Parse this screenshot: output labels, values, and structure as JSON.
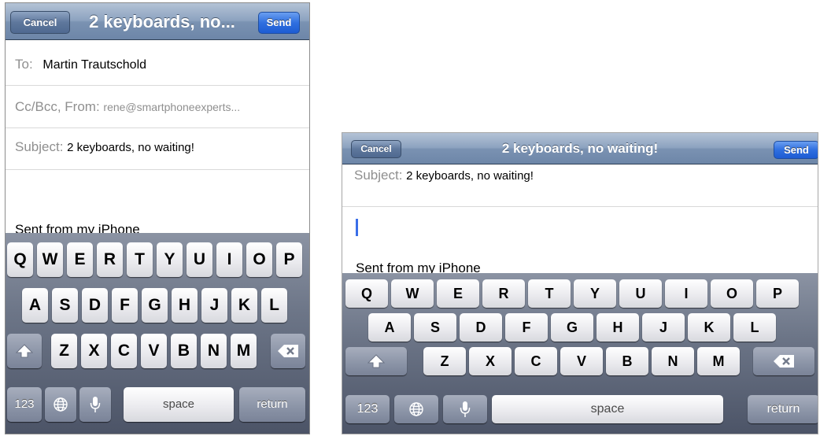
{
  "portrait": {
    "nav": {
      "cancel_label": "Cancel",
      "title": "2 keyboards, no...",
      "send_label": "Send"
    },
    "to": {
      "label": "To:",
      "value": "Martin Trautschold"
    },
    "ccbcc": {
      "label": "Cc/Bcc, From:",
      "value": "rene@smartphoneexperts..."
    },
    "subject": {
      "label": "Subject:",
      "value": "2 keyboards, no waiting!"
    },
    "signature": "Sent from my iPhone",
    "keyboard": {
      "row1": [
        "Q",
        "W",
        "E",
        "R",
        "T",
        "Y",
        "U",
        "I",
        "O",
        "P"
      ],
      "row2": [
        "A",
        "S",
        "D",
        "F",
        "G",
        "H",
        "J",
        "K",
        "L"
      ],
      "row3": [
        "Z",
        "X",
        "C",
        "V",
        "B",
        "N",
        "M"
      ],
      "numbers_label": "123",
      "space_label": "space",
      "return_label": "return"
    }
  },
  "landscape": {
    "nav": {
      "cancel_label": "Cancel",
      "title": "2 keyboards, no waiting!",
      "send_label": "Send"
    },
    "subject": {
      "label": "Subject:",
      "value": "2 keyboards, no waiting!"
    },
    "signature": "Sent from my iPhone",
    "keyboard": {
      "row1": [
        "Q",
        "W",
        "E",
        "R",
        "T",
        "Y",
        "U",
        "I",
        "O",
        "P"
      ],
      "row2": [
        "A",
        "S",
        "D",
        "F",
        "G",
        "H",
        "J",
        "K",
        "L"
      ],
      "row3": [
        "Z",
        "X",
        "C",
        "V",
        "B",
        "N",
        "M"
      ],
      "numbers_label": "123",
      "space_label": "space",
      "return_label": "return"
    }
  },
  "icons": {
    "shift": "shift-arrow-icon",
    "delete": "backspace-icon",
    "globe": "globe-icon",
    "mic": "microphone-icon"
  }
}
